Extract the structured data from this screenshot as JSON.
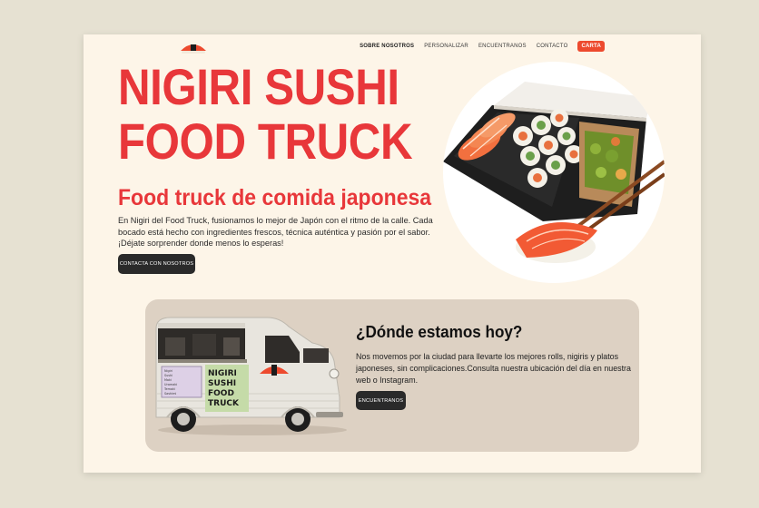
{
  "nav": {
    "items": [
      {
        "label": "SOBRE NOSOTROS",
        "active": true
      },
      {
        "label": "PERSONALIZAR",
        "active": false
      },
      {
        "label": "ENCUENTRANOS",
        "active": false
      },
      {
        "label": "CONTACTO",
        "active": false
      }
    ],
    "cta": "CARTA"
  },
  "hero": {
    "title_line1": "NIGIRI SUSHI",
    "title_line2": "FOOD TRUCK",
    "subtitle": "Food truck de comida japonesa",
    "description": "En Nigiri del Food Truck, fusionamos lo mejor de Japón con el ritmo de la calle. Cada bocado está hecho con ingredientes frescos, técnica auténtica y pasión por el sabor. ¡Déjate sorprender donde menos lo esperas!",
    "button": "CONTACTA CON NOSOTROS"
  },
  "location": {
    "title": "¿Dónde estamos hoy?",
    "description": "Nos movemos por la ciudad para llevarte los mejores rolls, nigiris y platos japoneses, sin complicaciones.Consulta nuestra ubicación del día en nuestra web o Instagram.",
    "button": "ENCUENTRANOS"
  },
  "truck": {
    "sign_lines": [
      "NIGIRI",
      "SUSHI",
      "FOOD",
      "TRUCK"
    ],
    "menu_items": [
      "Nigiri",
      "Sushi",
      "Maki",
      "Uramaki",
      "Temaki",
      "Sashimi"
    ]
  },
  "colors": {
    "accent": "#e8373a",
    "cta": "#ed4a2e",
    "page_bg": "#fdf5e8",
    "outer_bg": "#e6e1d2",
    "card_bg": "#ddd1c3",
    "button_dark": "#2a2a2a"
  }
}
